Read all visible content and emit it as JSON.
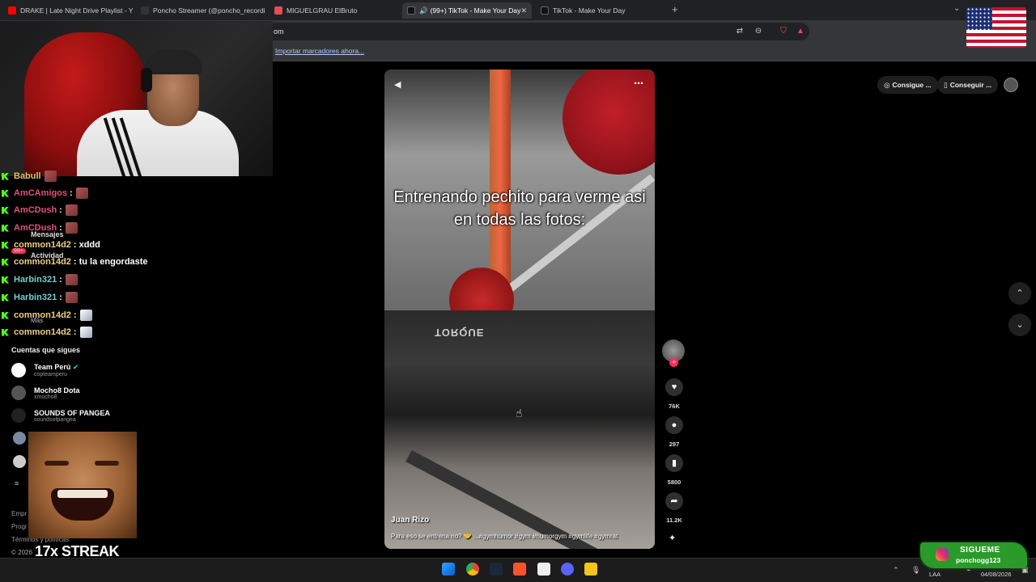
{
  "browser": {
    "tabs": [
      {
        "label": "DRAKE | Late Night Drive Playlist - Yo",
        "fav_color": "#ff0000"
      },
      {
        "label": "Poncho Streamer (@poncho_recordi",
        "fav_color": "#111111"
      },
      {
        "label": "MIGUELGRAU ElBruto",
        "fav_color": "#e05050"
      },
      {
        "label": "(99+) TikTok - Make Your Day",
        "fav_color": "#111111",
        "active": true
      },
      {
        "label": "TikTok - Make Your Day",
        "fav_color": "#111111"
      }
    ],
    "address": "om",
    "bookmarks_import": "Importar marcadores ahora..."
  },
  "chat": {
    "messages": [
      {
        "user": "Babull",
        "text": "",
        "color": "#e8c060",
        "emote": "brown"
      },
      {
        "user": "AmCAmigos",
        "text": "",
        "color": "#e0507a",
        "emote": "brown"
      },
      {
        "user": "AmCDush",
        "text": "",
        "color": "#e0507a",
        "emote": "brown"
      },
      {
        "user": "AmCDush",
        "text": "",
        "color": "#e0507a",
        "emote": "brown"
      },
      {
        "user": "common14d2",
        "text": "xddd",
        "color": "#f0d080",
        "emote": ""
      },
      {
        "user": "common14d2",
        "text": "tu la engordaste",
        "color": "#f0d080",
        "emote": ""
      },
      {
        "user": "Harbin321",
        "text": "",
        "color": "#70d0d0",
        "emote": "brown"
      },
      {
        "user": "Harbin321",
        "text": "",
        "color": "#70d0d0",
        "emote": "brown"
      },
      {
        "user": "common14d2",
        "text": "",
        "color": "#f0d080",
        "emote": "face"
      },
      {
        "user": "common14d2",
        "text": "",
        "color": "#f0d080",
        "emote": "face"
      }
    ]
  },
  "sidebar": {
    "items": [
      {
        "label": "Mensajes"
      },
      {
        "label": "Actividad",
        "badge": "99+"
      },
      {
        "label": "Más"
      }
    ],
    "following_title": "Cuentas que sigues",
    "following": [
      {
        "name": "Team Perú",
        "handle": "copteamperu",
        "verified": "✔"
      },
      {
        "name": "Mocho8 Dota",
        "handle": "xmocho8",
        "verified": ""
      },
      {
        "name": "SOUNDS OF PANGEA",
        "handle": "soundsofpangea",
        "verified": ""
      }
    ],
    "footer_lines": [
      "Empr",
      "Progr",
      "Términos y políticas"
    ],
    "copyright": "© 2026"
  },
  "overlays": {
    "streak": "17x STREAK",
    "instagram_title": "SIGUEME",
    "instagram_handle": "ponchogg123"
  },
  "video": {
    "caption": "Entrenando pechito para verme asi en todas las fotos:",
    "author": "Juan Rizo",
    "description": "Para eso se entrena no? 🤝 ...#gymhumor #gym #humorgym #gymlife #gymrat",
    "equipment_brand": "TORQUE"
  },
  "actions": {
    "likes": "76K",
    "comments": "297",
    "saves": "5800",
    "shares": "11.2K"
  },
  "header": {
    "get_coins": "Consigue ...",
    "get_app": "Conseguir ..."
  },
  "taskbar": {
    "lang": "LAA",
    "date": "04/08/2026"
  },
  "icons": {
    "like": "heart-icon",
    "comment": "comment-icon",
    "save": "bookmark-icon",
    "share": "share-icon"
  },
  "colors": {
    "tiktok_red": "#fe2c55",
    "kick_green": "#53fc18",
    "insta_bg": "#2a9a2a"
  }
}
